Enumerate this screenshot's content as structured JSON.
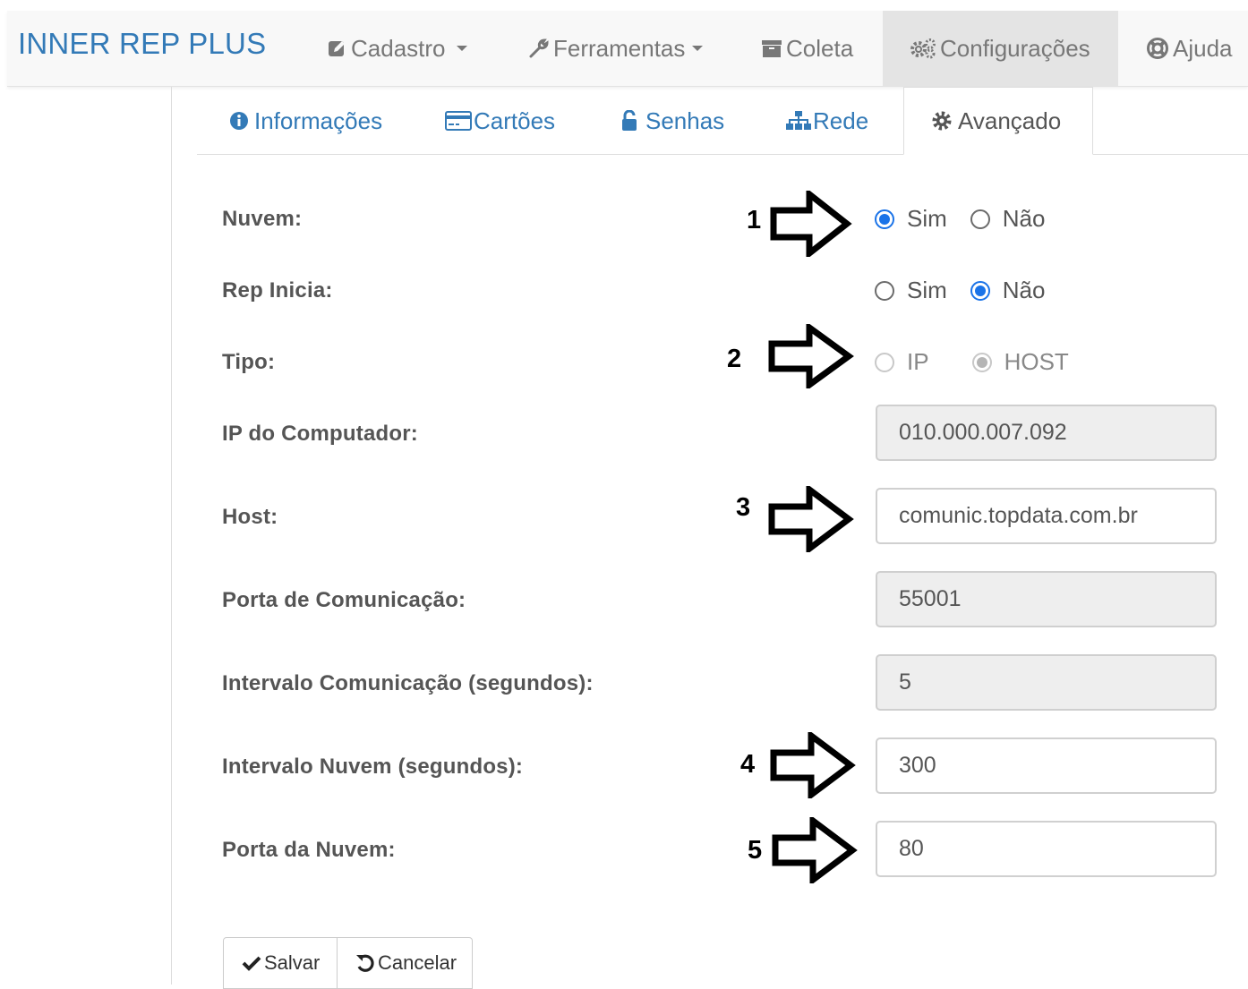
{
  "navbar": {
    "brand": "INNER REP PLUS",
    "items": [
      {
        "label": "Cadastro",
        "icon": "edit-icon",
        "dropdown": true
      },
      {
        "label": "Ferramentas",
        "icon": "wrench-icon",
        "dropdown": true
      },
      {
        "label": "Coleta",
        "icon": "archive-icon",
        "dropdown": false
      },
      {
        "label": "Configurações",
        "icon": "cogs-icon",
        "dropdown": false,
        "active": true
      },
      {
        "label": "Ajuda",
        "icon": "lifebuoy-icon",
        "dropdown": false
      }
    ]
  },
  "tabs": [
    {
      "label": "Informações",
      "icon": "info-circle-icon"
    },
    {
      "label": "Cartões",
      "icon": "credit-card-icon"
    },
    {
      "label": "Senhas",
      "icon": "unlock-icon"
    },
    {
      "label": "Rede",
      "icon": "sitemap-icon"
    },
    {
      "label": "Avançado",
      "icon": "gear-icon",
      "active": true
    }
  ],
  "form": {
    "nuvem": {
      "label": "Nuvem:",
      "options": [
        "Sim",
        "Não"
      ],
      "selected": "Sim"
    },
    "rep_inicia": {
      "label": "Rep Inicia:",
      "options": [
        "Sim",
        "Não"
      ],
      "selected": "Não"
    },
    "tipo": {
      "label": "Tipo:",
      "options": [
        "IP",
        "HOST"
      ],
      "selected": "HOST",
      "disabled": true
    },
    "ip_computador": {
      "label": "IP do Computador:",
      "value": "010.000.007.092",
      "readonly": true
    },
    "host": {
      "label": "Host:",
      "value": "comunic.topdata.com.br",
      "readonly": false
    },
    "porta_comunicacao": {
      "label": "Porta de Comunicação:",
      "value": "55001",
      "readonly": true
    },
    "intervalo_comunicacao": {
      "label": "Intervalo Comunicação (segundos):",
      "value": "5",
      "readonly": true
    },
    "intervalo_nuvem": {
      "label": "Intervalo Nuvem (segundos):",
      "value": "300",
      "readonly": false
    },
    "porta_nuvem": {
      "label": "Porta da Nuvem:",
      "value": "80",
      "readonly": false
    }
  },
  "annotations": [
    "1",
    "2",
    "3",
    "4",
    "5"
  ],
  "buttons": {
    "save": "Salvar",
    "cancel": "Cancelar"
  }
}
